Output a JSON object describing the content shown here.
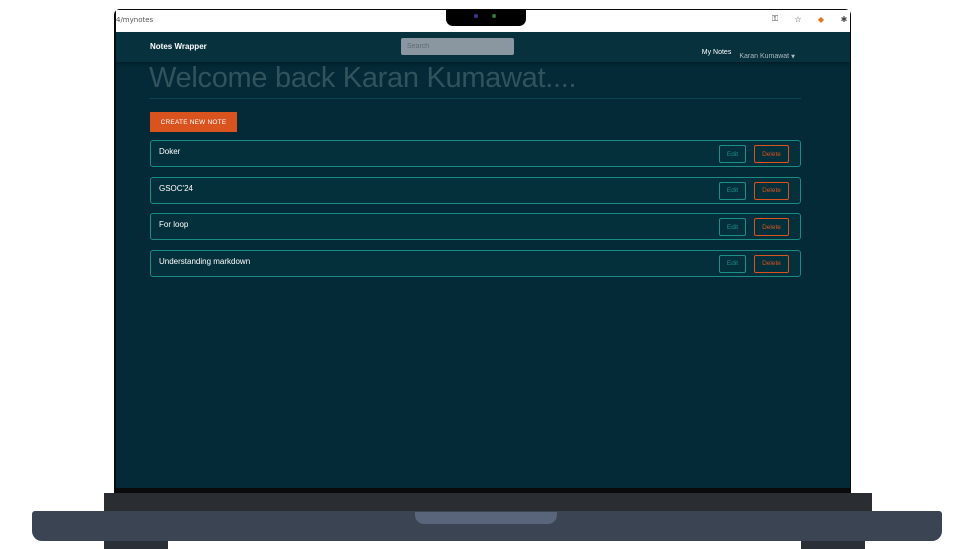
{
  "browser": {
    "url": "4/mynotes",
    "icons": [
      "key-icon",
      "star-icon",
      "metamask-fox-icon",
      "extension-icon"
    ]
  },
  "navbar": {
    "brand": "Notes Wrapper",
    "search_placeholder": "Search",
    "my_notes_label": "My Notes",
    "user_name": "Karan Kumawat"
  },
  "main": {
    "welcome": "Welcome back Karan Kumawat....",
    "create_label": "CREATE NEW NOTE",
    "notes": [
      {
        "title": "Doker",
        "edit_label": "Edit",
        "delete_label": "Delete"
      },
      {
        "title": "GSOC'24",
        "edit_label": "Edit",
        "delete_label": "Delete"
      },
      {
        "title": "For loop",
        "edit_label": "Edit",
        "delete_label": "Delete"
      },
      {
        "title": "Understanding markdown",
        "edit_label": "Edit",
        "delete_label": "Delete"
      }
    ]
  },
  "colors": {
    "background": "#032a36",
    "accent_orange": "#d9531e",
    "accent_teal": "#1e8f86"
  }
}
